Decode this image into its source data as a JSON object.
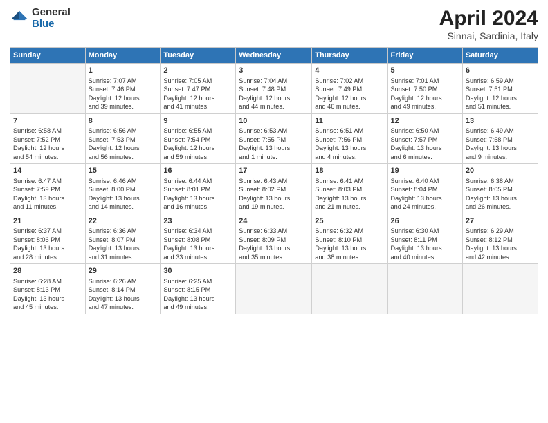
{
  "logo": {
    "general": "General",
    "blue": "Blue"
  },
  "title": {
    "month": "April 2024",
    "location": "Sinnai, Sardinia, Italy"
  },
  "headers": [
    "Sunday",
    "Monday",
    "Tuesday",
    "Wednesday",
    "Thursday",
    "Friday",
    "Saturday"
  ],
  "weeks": [
    [
      {
        "day": "",
        "info": ""
      },
      {
        "day": "1",
        "info": "Sunrise: 7:07 AM\nSunset: 7:46 PM\nDaylight: 12 hours\nand 39 minutes."
      },
      {
        "day": "2",
        "info": "Sunrise: 7:05 AM\nSunset: 7:47 PM\nDaylight: 12 hours\nand 41 minutes."
      },
      {
        "day": "3",
        "info": "Sunrise: 7:04 AM\nSunset: 7:48 PM\nDaylight: 12 hours\nand 44 minutes."
      },
      {
        "day": "4",
        "info": "Sunrise: 7:02 AM\nSunset: 7:49 PM\nDaylight: 12 hours\nand 46 minutes."
      },
      {
        "day": "5",
        "info": "Sunrise: 7:01 AM\nSunset: 7:50 PM\nDaylight: 12 hours\nand 49 minutes."
      },
      {
        "day": "6",
        "info": "Sunrise: 6:59 AM\nSunset: 7:51 PM\nDaylight: 12 hours\nand 51 minutes."
      }
    ],
    [
      {
        "day": "7",
        "info": "Sunrise: 6:58 AM\nSunset: 7:52 PM\nDaylight: 12 hours\nand 54 minutes."
      },
      {
        "day": "8",
        "info": "Sunrise: 6:56 AM\nSunset: 7:53 PM\nDaylight: 12 hours\nand 56 minutes."
      },
      {
        "day": "9",
        "info": "Sunrise: 6:55 AM\nSunset: 7:54 PM\nDaylight: 12 hours\nand 59 minutes."
      },
      {
        "day": "10",
        "info": "Sunrise: 6:53 AM\nSunset: 7:55 PM\nDaylight: 13 hours\nand 1 minute."
      },
      {
        "day": "11",
        "info": "Sunrise: 6:51 AM\nSunset: 7:56 PM\nDaylight: 13 hours\nand 4 minutes."
      },
      {
        "day": "12",
        "info": "Sunrise: 6:50 AM\nSunset: 7:57 PM\nDaylight: 13 hours\nand 6 minutes."
      },
      {
        "day": "13",
        "info": "Sunrise: 6:49 AM\nSunset: 7:58 PM\nDaylight: 13 hours\nand 9 minutes."
      }
    ],
    [
      {
        "day": "14",
        "info": "Sunrise: 6:47 AM\nSunset: 7:59 PM\nDaylight: 13 hours\nand 11 minutes."
      },
      {
        "day": "15",
        "info": "Sunrise: 6:46 AM\nSunset: 8:00 PM\nDaylight: 13 hours\nand 14 minutes."
      },
      {
        "day": "16",
        "info": "Sunrise: 6:44 AM\nSunset: 8:01 PM\nDaylight: 13 hours\nand 16 minutes."
      },
      {
        "day": "17",
        "info": "Sunrise: 6:43 AM\nSunset: 8:02 PM\nDaylight: 13 hours\nand 19 minutes."
      },
      {
        "day": "18",
        "info": "Sunrise: 6:41 AM\nSunset: 8:03 PM\nDaylight: 13 hours\nand 21 minutes."
      },
      {
        "day": "19",
        "info": "Sunrise: 6:40 AM\nSunset: 8:04 PM\nDaylight: 13 hours\nand 24 minutes."
      },
      {
        "day": "20",
        "info": "Sunrise: 6:38 AM\nSunset: 8:05 PM\nDaylight: 13 hours\nand 26 minutes."
      }
    ],
    [
      {
        "day": "21",
        "info": "Sunrise: 6:37 AM\nSunset: 8:06 PM\nDaylight: 13 hours\nand 28 minutes."
      },
      {
        "day": "22",
        "info": "Sunrise: 6:36 AM\nSunset: 8:07 PM\nDaylight: 13 hours\nand 31 minutes."
      },
      {
        "day": "23",
        "info": "Sunrise: 6:34 AM\nSunset: 8:08 PM\nDaylight: 13 hours\nand 33 minutes."
      },
      {
        "day": "24",
        "info": "Sunrise: 6:33 AM\nSunset: 8:09 PM\nDaylight: 13 hours\nand 35 minutes."
      },
      {
        "day": "25",
        "info": "Sunrise: 6:32 AM\nSunset: 8:10 PM\nDaylight: 13 hours\nand 38 minutes."
      },
      {
        "day": "26",
        "info": "Sunrise: 6:30 AM\nSunset: 8:11 PM\nDaylight: 13 hours\nand 40 minutes."
      },
      {
        "day": "27",
        "info": "Sunrise: 6:29 AM\nSunset: 8:12 PM\nDaylight: 13 hours\nand 42 minutes."
      }
    ],
    [
      {
        "day": "28",
        "info": "Sunrise: 6:28 AM\nSunset: 8:13 PM\nDaylight: 13 hours\nand 45 minutes."
      },
      {
        "day": "29",
        "info": "Sunrise: 6:26 AM\nSunset: 8:14 PM\nDaylight: 13 hours\nand 47 minutes."
      },
      {
        "day": "30",
        "info": "Sunrise: 6:25 AM\nSunset: 8:15 PM\nDaylight: 13 hours\nand 49 minutes."
      },
      {
        "day": "",
        "info": ""
      },
      {
        "day": "",
        "info": ""
      },
      {
        "day": "",
        "info": ""
      },
      {
        "day": "",
        "info": ""
      }
    ]
  ]
}
